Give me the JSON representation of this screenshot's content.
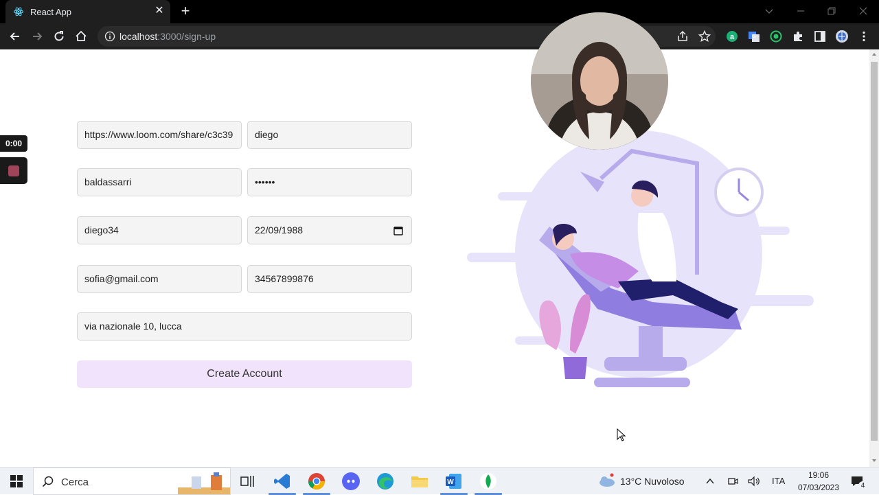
{
  "browser": {
    "tab_title": "React App",
    "url_host": "localhost",
    "url_rest": ":3000/sign-up"
  },
  "form": {
    "field1": "https://www.loom.com/share/c3c39",
    "field2": "diego",
    "field3": "baldassarri",
    "field4": "••••••",
    "field5": "diego34",
    "field6": "22/09/1988",
    "field7": "sofia@gmail.com",
    "field8": "34567899876",
    "field9": "via nazionale 10, lucca",
    "submit_label": "Create Account"
  },
  "loom": {
    "timer": "0:00"
  },
  "taskbar": {
    "search_label": "Cerca",
    "weather": "13°C  Nuvoloso",
    "language": "ITA",
    "time": "19:06",
    "date": "07/03/2023",
    "notification_count": "4"
  },
  "colors": {
    "accent_button": "#f1e3fb",
    "illustration_purple": "#9a87e0"
  }
}
